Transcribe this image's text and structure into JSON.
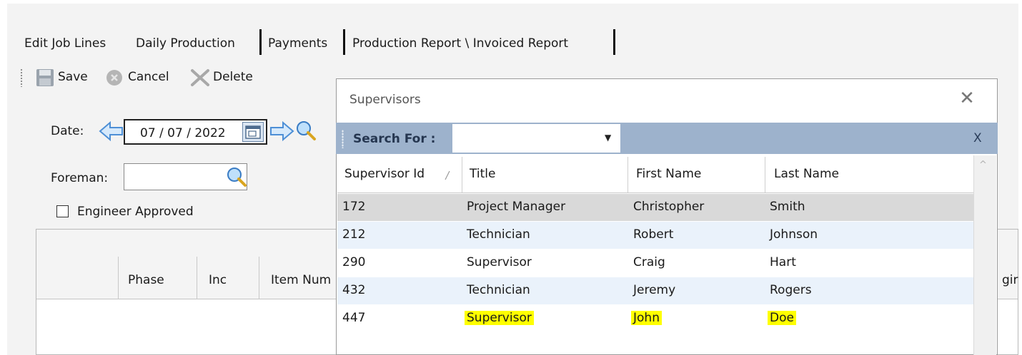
{
  "tabs": [
    {
      "label": "Edit Job Lines"
    },
    {
      "label": "Daily Production"
    },
    {
      "label": "Payments"
    },
    {
      "label": "Production Report \\ Invoiced Report"
    }
  ],
  "toolbar": {
    "save": "Save",
    "cancel": "Cancel",
    "delete": "Delete"
  },
  "form": {
    "date_label": "Date:",
    "date_value": "07 / 07 / 2022",
    "foreman_label": "Foreman:",
    "foreman_value": "",
    "engineer_approved_label": "Engineer Approved",
    "engineer_approved_checked": false
  },
  "background_grid": {
    "columns": [
      "Phase",
      "Inc",
      "Item Num",
      "gir"
    ]
  },
  "dialog": {
    "title": "Supervisors",
    "search_label": "Search For :",
    "search_value": "",
    "clear_label": "X",
    "columns": [
      "Supervisor Id",
      "Title",
      "First Name",
      "Last Name"
    ],
    "rows": [
      {
        "id": "172",
        "title": "Project Manager",
        "first": "Christopher",
        "last": "Smith",
        "selected": true
      },
      {
        "id": "212",
        "title": "Technician",
        "first": "Robert",
        "last": "Johnson"
      },
      {
        "id": "290",
        "title": "Supervisor",
        "first": "Craig",
        "last": "Hart"
      },
      {
        "id": "432",
        "title": "Technician",
        "first": "Jeremy",
        "last": "Rogers"
      },
      {
        "id": "447",
        "title": "Supervisor",
        "first": "John",
        "last": "Doe",
        "highlighted": true
      }
    ]
  },
  "colors": {
    "search_bar": "#9db2cc",
    "selected_row": "#d9d9d9",
    "alt_row": "#eaf2fb",
    "highlight": "#ffff00",
    "arrow_blue": "#4d8fd6"
  }
}
